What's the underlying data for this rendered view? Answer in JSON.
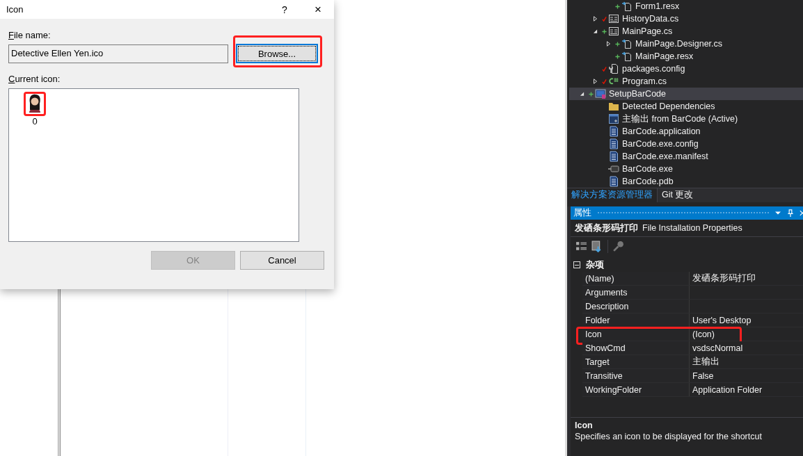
{
  "dialog": {
    "title": "Icon",
    "help": "?",
    "close": "×",
    "file_label": "File name:",
    "file_value": "Detective Ellen Yen.ico",
    "browse": {
      "label": "Browse...",
      "highlighted": true,
      "focused": true
    },
    "current_label": "Current icon:",
    "icons": [
      {
        "index": "0",
        "highlighted": true,
        "kind": "person"
      }
    ],
    "buttons": [
      {
        "label": "OK",
        "disabled": true
      },
      {
        "label": "Cancel",
        "disabled": false
      }
    ]
  },
  "solution_explorer": {
    "cut_top_child": {
      "label": "Form1.resx",
      "kind": "designer",
      "added": true
    },
    "items": [
      {
        "label": "HistoryData.cs",
        "kind": "form",
        "added": false,
        "expanded": false
      },
      {
        "label": "MainPage.cs",
        "kind": "form",
        "added": true,
        "expanded": true,
        "children": [
          {
            "label": "MainPage.Designer.cs",
            "kind": "designer",
            "added": true,
            "expanded": false
          },
          {
            "label": "MainPage.resx",
            "kind": "designer",
            "added": true
          }
        ]
      },
      {
        "label": "packages.config",
        "kind": "config",
        "added": false
      },
      {
        "label": "Program.cs",
        "kind": "csharp",
        "added": false,
        "expanded": false
      }
    ],
    "setup_project": {
      "label": "SetupBarCode",
      "kind": "setup",
      "added": true,
      "expanded": true,
      "selected": true,
      "children": [
        {
          "label": "Detected Dependencies",
          "kind": "folder"
        },
        {
          "label": "主输出 from BarCode (Active)",
          "kind": "output"
        },
        {
          "label": "BarCode.application",
          "kind": "file"
        },
        {
          "label": "BarCode.exe.config",
          "kind": "file"
        },
        {
          "label": "BarCode.exe.manifest",
          "kind": "file"
        },
        {
          "label": "BarCode.exe",
          "kind": "exe"
        },
        {
          "label": "BarCode.pdb",
          "kind": "file"
        }
      ]
    },
    "tabs": [
      {
        "label": "解决方案资源管理器",
        "selected": true
      },
      {
        "label": "Git 更改",
        "selected": false
      }
    ]
  },
  "properties": {
    "title": "属性",
    "object_name": "发硒条形码打印",
    "object_type": "File Installation Properties",
    "category": {
      "label": "杂项",
      "expanded": true
    },
    "rows": [
      {
        "name": "(Name)",
        "value": "发硒条形码打印",
        "highlighted": false
      },
      {
        "name": "Arguments",
        "highlighted": false
      },
      {
        "name": "Description",
        "highlighted": false
      },
      {
        "name": "Folder",
        "value": "User's Desktop",
        "highlighted": false
      },
      {
        "name": "Icon",
        "value": "(Icon)",
        "highlighted": true
      },
      {
        "name": "ShowCmd",
        "value": "vsdscNormal",
        "highlighted": false
      },
      {
        "name": "Target",
        "value": "主输出",
        "highlighted": false
      },
      {
        "name": "Transitive",
        "value": "False",
        "highlighted": false
      },
      {
        "name": "WorkingFolder",
        "value": "Application Folder",
        "highlighted": false
      }
    ],
    "description": {
      "title": "Icon",
      "text": "Specifies an icon to be displayed for the shortcut"
    }
  }
}
